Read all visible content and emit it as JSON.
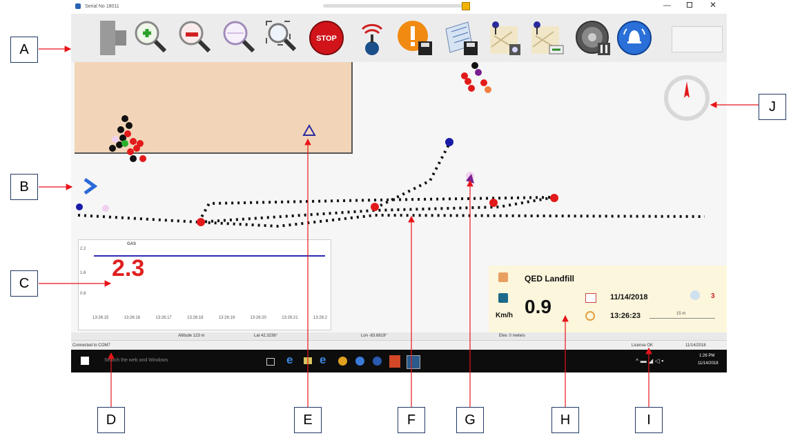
{
  "window": {
    "title": "Serial No 18011"
  },
  "callouts": [
    "A",
    "B",
    "C",
    "D",
    "E",
    "F",
    "G",
    "H",
    "I",
    "J"
  ],
  "gas": {
    "label": "GAS",
    "value": "2.3",
    "y_ticks": [
      "2.2",
      "1.6",
      "0.8"
    ],
    "x_ticks": [
      "13:26:15",
      "13:26:16",
      "13:26:17",
      "13:26:18",
      "13:26:19",
      "13:26:20",
      "13:26:21",
      "13:26:2"
    ]
  },
  "status": {
    "altitude": "Altitude   123 m",
    "lat": "Lat 42.3236°",
    "lon": "Lon -83.6819°",
    "elev": "Elev.   0 meters",
    "connected": "Connected to  COM7",
    "license": "License OK",
    "date_small": "11/14/2018"
  },
  "info": {
    "site": "QED Landfill",
    "speed": "0.9",
    "speed_unit": "Km/h",
    "date": "11/14/2018",
    "time": "13:26:23",
    "satellites": "3",
    "scale": "15 m"
  },
  "taskbar": {
    "search_placeholder": "Search the web and Windows",
    "clock_time": "1:26 PM",
    "clock_date": "11/14/2018"
  },
  "colors": {
    "accent_red": "#e02020",
    "nav_blue": "#2a2aa0",
    "panel_bg": "#fcf6dc",
    "site_bg": "#f2d5b8"
  }
}
